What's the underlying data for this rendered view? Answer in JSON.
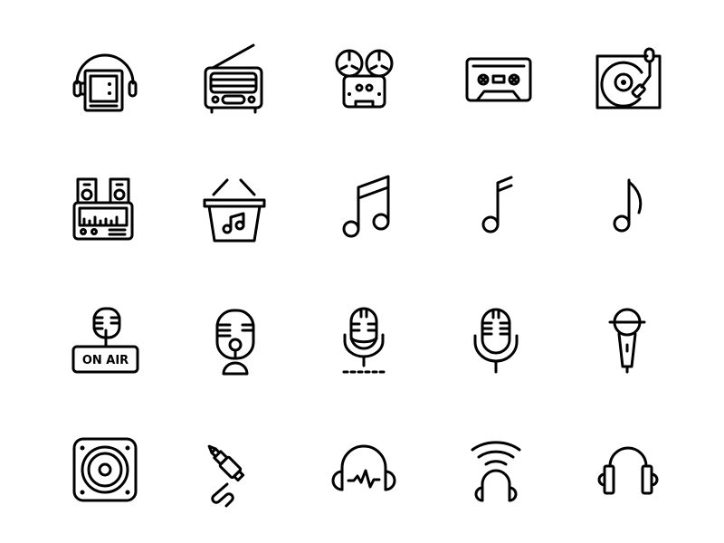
{
  "background_color": "#ffffff",
  "stroke_color": "#000000",
  "icons": [
    {
      "name": "walkman-headphones-icon",
      "label": "Portable cassette player with headphones"
    },
    {
      "name": "vintage-radio-icon",
      "label": "Vintage radio"
    },
    {
      "name": "reel-to-reel-icon",
      "label": "Reel-to-reel tape recorder"
    },
    {
      "name": "cassette-tape-icon",
      "label": "Cassette tape"
    },
    {
      "name": "turntable-icon",
      "label": "Record player turntable"
    },
    {
      "name": "stereo-system-icon",
      "label": "Stereo system with speakers"
    },
    {
      "name": "music-basket-icon",
      "label": "Music shopping basket"
    },
    {
      "name": "beamed-notes-icon",
      "label": "Beamed eighth notes"
    },
    {
      "name": "sixteenth-note-icon",
      "label": "Sixteenth note"
    },
    {
      "name": "eighth-note-icon",
      "label": "Eighth note"
    },
    {
      "name": "on-air-microphone-icon",
      "label": "On air microphone",
      "badge_text": "ON AIR"
    },
    {
      "name": "podcast-microphone-icon",
      "label": "Podcast microphone"
    },
    {
      "name": "studio-microphone-icon",
      "label": "Studio microphone with stand"
    },
    {
      "name": "vintage-microphone-icon",
      "label": "Vintage microphone"
    },
    {
      "name": "handheld-microphone-icon",
      "label": "Handheld microphone"
    },
    {
      "name": "speaker-icon",
      "label": "Speaker woofer"
    },
    {
      "name": "audio-jack-icon",
      "label": "Audio jack cable"
    },
    {
      "name": "headphones-waveform-icon",
      "label": "Headphones with sound wave"
    },
    {
      "name": "wireless-headphones-icon",
      "label": "Wireless headphones"
    },
    {
      "name": "headphones-icon",
      "label": "Headphones"
    }
  ]
}
